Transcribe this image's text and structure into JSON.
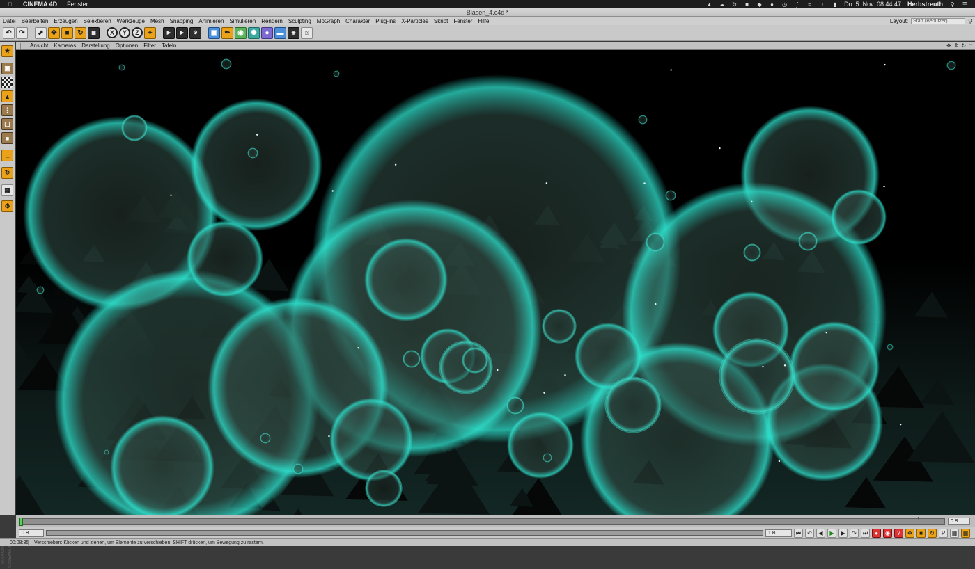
{
  "macbar": {
    "app_name": "CINEMA 4D",
    "menu_item": "Fenster",
    "datetime": "Do. 5. Nov.  08:44:47",
    "user": "Herbstreuth"
  },
  "window": {
    "title": "Blasen_4.c4d *"
  },
  "menu": {
    "items": [
      "Datei",
      "Bearbeiten",
      "Erzeugen",
      "Selektieren",
      "Werkzeuge",
      "Mesh",
      "Snapping",
      "Animieren",
      "Simulieren",
      "Rendern",
      "Sculpting",
      "MoGraph",
      "Charakter",
      "Plug-ins",
      "X-Particles",
      "Skript",
      "Fenster",
      "Hilfe"
    ],
    "layout_label": "Layout:",
    "layout_value": "Start (Benutzer)"
  },
  "toolbar": {
    "axis_x": "X",
    "axis_y": "Y",
    "axis_z": "Z"
  },
  "viewport_menu": {
    "items": [
      "Ansicht",
      "Kameras",
      "Darstellung",
      "Optionen",
      "Filter",
      "Tafeln"
    ]
  },
  "timeline": {
    "current_frame": "0 B",
    "marker_label": "1",
    "end_frame": "0 B",
    "start_field": "0 B",
    "fps_field": "1 B"
  },
  "status": {
    "time": "00:08:35",
    "message": "Verschieben: Klicken und ziehen, um Elemente zu verschieben. SHIFT drücken, um Bewegung zu rastern."
  },
  "maxon_logo": "MAXON CINEMA4D",
  "colors": {
    "bubble": "#2fe3cf",
    "bubble_fill": "#2a3a33",
    "background": "#000000"
  }
}
